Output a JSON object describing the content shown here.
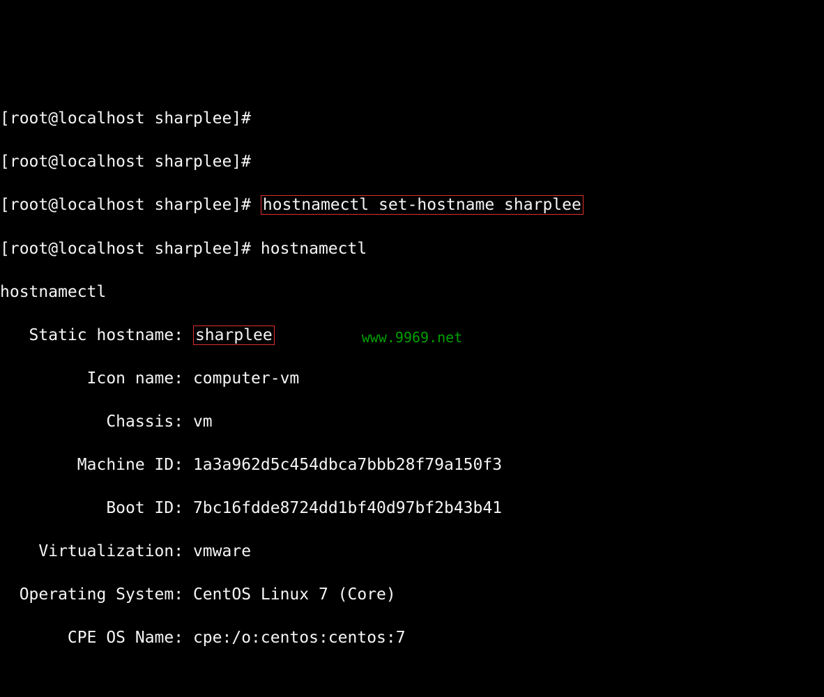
{
  "prompts": [
    "[root@localhost sharplee]#",
    "[root@localhost sharplee]#",
    "[root@localhost sharplee]# ",
    "[root@localhost sharplee]# "
  ],
  "command1": "hostnamectl set-hostname sharplee",
  "command2": "hostnamectl",
  "echo_line": "hostnamectl",
  "info": {
    "static_hostname_label": "   Static hostname: ",
    "static_hostname_value": "sharplee",
    "icon_name_label": "         Icon name: ",
    "icon_name_value": "computer-vm",
    "chassis_label": "           Chassis: ",
    "chassis_value": "vm",
    "machine_id_label": "        Machine ID: ",
    "machine_id_value": "1a3a962d5c454dbca7bbb28f79a150f3",
    "boot_id_label": "           Boot ID: ",
    "boot_id_value": "7bc16fdde8724dd1bf40d97bf2b43b41",
    "virtualization_label": "    Virtualization: ",
    "virtualization_value": "vmware",
    "os_label": "  Operating System: ",
    "os_value": "CentOS Linux 7 (Core)",
    "cpe_label": "       CPE OS Name: ",
    "cpe_value": "cpe:/o:centos:centos:7"
  },
  "watermark": "www.9969.net"
}
